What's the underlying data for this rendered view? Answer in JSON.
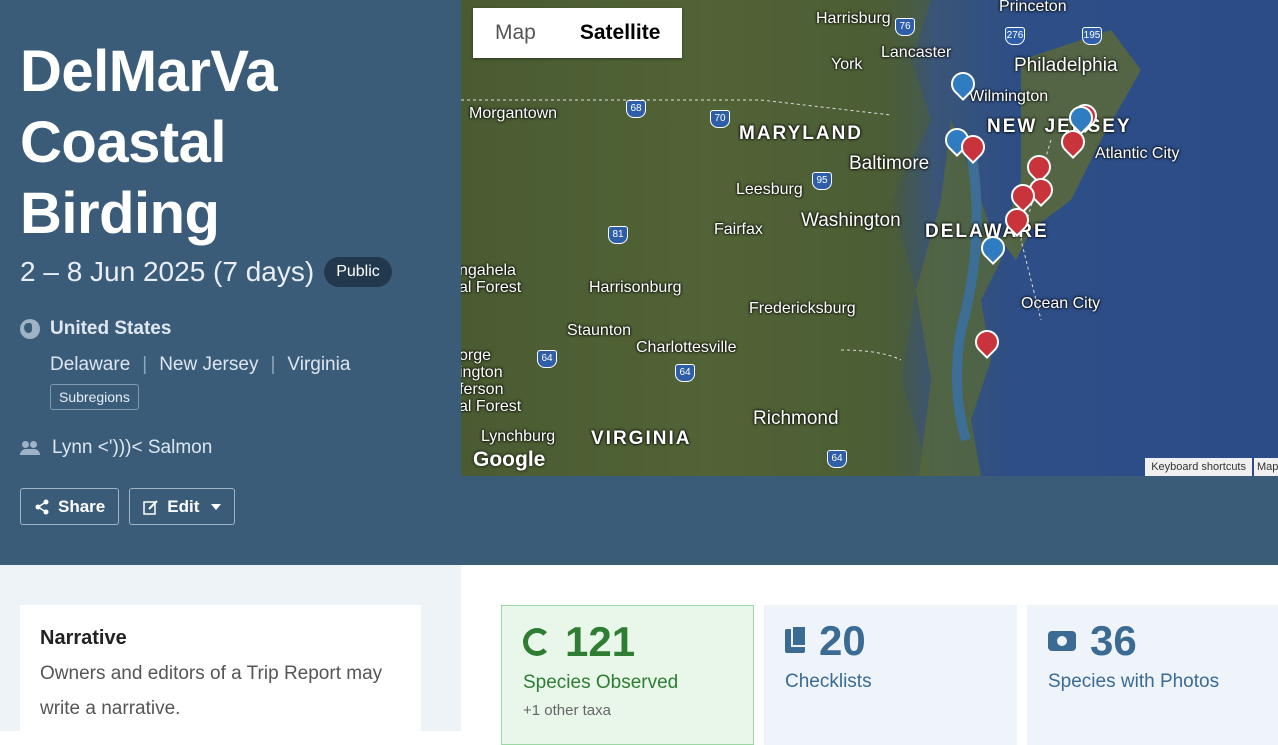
{
  "trip": {
    "title_lines": [
      "DelMarVa",
      "Coastal",
      "Birding"
    ],
    "dates": "2 – 8 Jun 2025 (7 days)",
    "visibility": "Public",
    "country": "United States",
    "regions": [
      "Delaware",
      "New Jersey",
      "Virginia"
    ],
    "subregions_label": "Subregions",
    "owner": "Lynn <')))< Salmon"
  },
  "actions": {
    "share": "Share",
    "edit": "Edit"
  },
  "map": {
    "toggle": {
      "map": "Map",
      "satellite": "Satellite"
    },
    "labels": {
      "harrisburg": "Harrisburg",
      "princeton": "Princeton",
      "lancaster": "Lancaster",
      "york": "York",
      "philadelphia": "Philadelphia",
      "wilmington": "Wilmington",
      "morgantown": "Morgantown",
      "maryland": "MARYLAND",
      "new_jersey": "NEW JERSEY",
      "baltimore": "Baltimore",
      "atlantic_city": "Atlantic City",
      "leesburg": "Leesburg",
      "washington": "Washington",
      "fairfax": "Fairfax",
      "delaware": "DELAWARE",
      "harrisonburg": "Harrisonburg",
      "fredericksburg": "Fredericksburg",
      "ocean_city": "Ocean City",
      "staunton": "Staunton",
      "charlottesville": "Charlottesville",
      "richmond": "Richmond",
      "lynchburg": "Lynchburg",
      "virginia": "VIRGINIA",
      "gahela_forest": "ngahela\nal Forest",
      "george_jefferson": "orge\nington\nferson\nal Forest"
    },
    "shields": [
      "76",
      "276",
      "195",
      "68",
      "70",
      "95",
      "81",
      "64",
      "64",
      "64"
    ],
    "google": "Google",
    "keyboard_shortcuts": "Keyboard shortcuts",
    "map_data": "Map"
  },
  "narrative": {
    "heading": "Narrative",
    "text": "Owners and editors of a Trip Report may write a narrative."
  },
  "stats": [
    {
      "value": "121",
      "label": "Species Observed",
      "sub": "+1 other taxa",
      "color": "#2e7d32"
    },
    {
      "value": "20",
      "label": "Checklists",
      "color": "#3b6a93"
    },
    {
      "value": "36",
      "label": "Species with Photos",
      "color": "#3b6a93"
    }
  ]
}
